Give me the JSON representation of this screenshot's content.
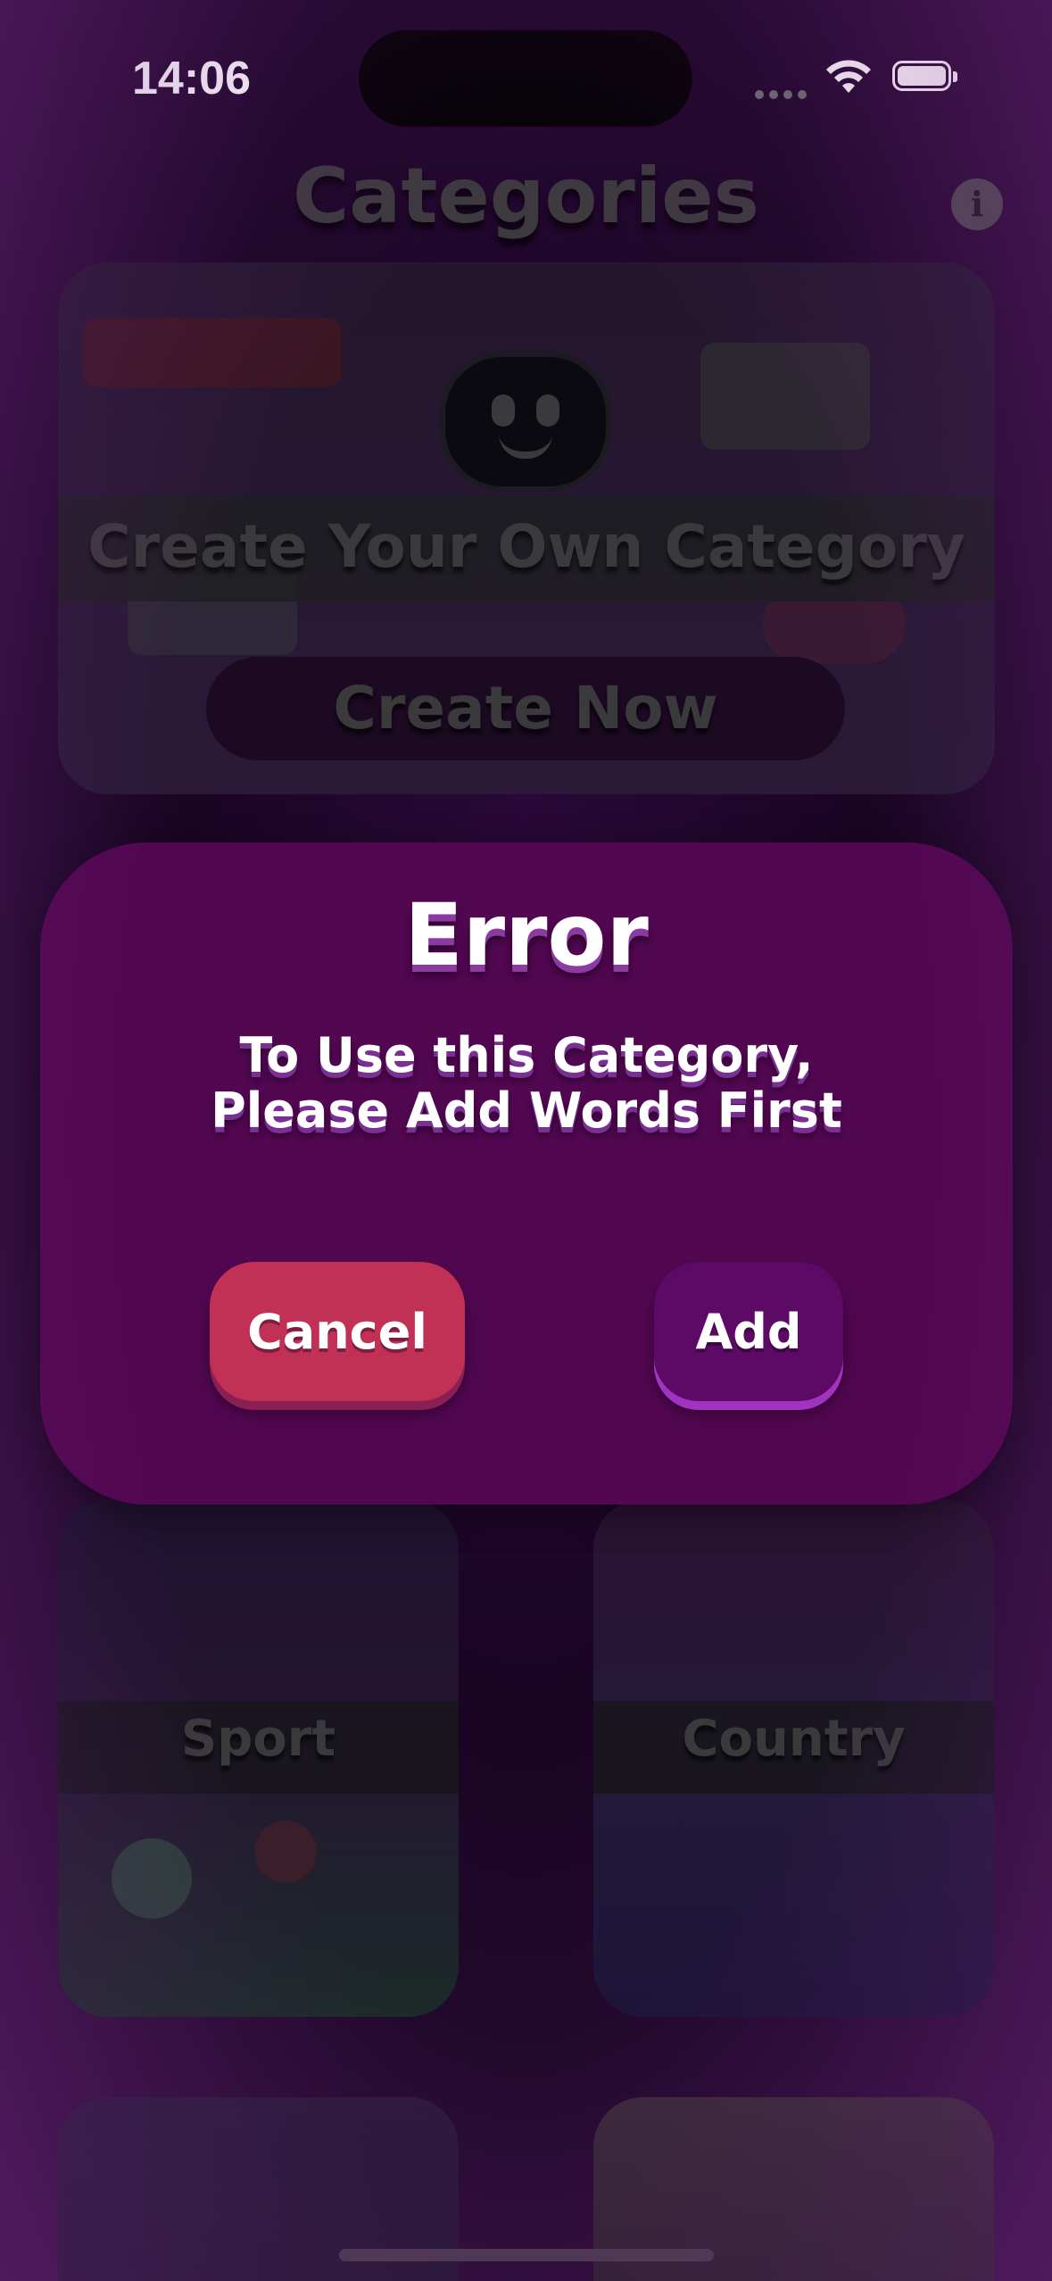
{
  "status_bar": {
    "time": "14:06",
    "icons": [
      "cellular-signal-icon",
      "wifi-icon",
      "battery-icon"
    ]
  },
  "header": {
    "title": "Categories",
    "info_icon": "i"
  },
  "create_card": {
    "title": "Create Your Own Category",
    "button_label": "Create Now"
  },
  "categories": [
    {
      "label": "Sport"
    },
    {
      "label": "Country"
    }
  ],
  "dialog": {
    "title": "Error",
    "message": "To Use this Category, Please Add Words First",
    "cancel_label": "Cancel",
    "add_label": "Add"
  },
  "colors": {
    "dialog_bg": "#520751",
    "cancel_button": "#c13055",
    "add_button": "#5d0a66"
  }
}
